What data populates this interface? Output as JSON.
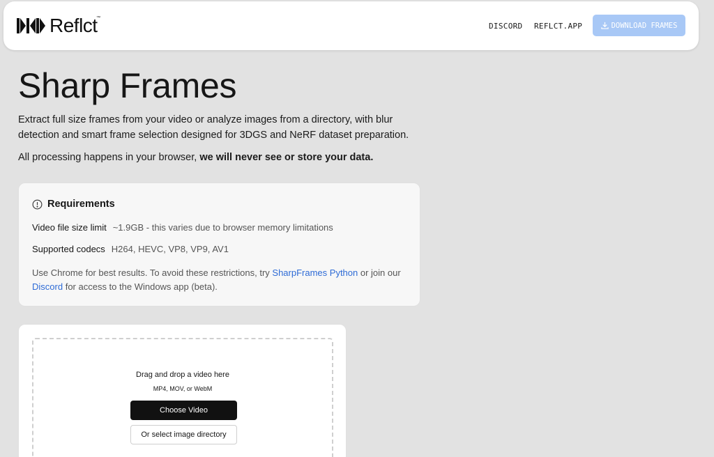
{
  "brand": {
    "name": "Reflct",
    "trademark": "™"
  },
  "nav": {
    "discord": "DISCORD",
    "app": "REFLCT.APP",
    "download": "DOWNLOAD FRAMES",
    "download_icon": "download-icon"
  },
  "hero": {
    "title": "Sharp Frames",
    "description": "Extract full size frames from your video or analyze images from a directory, with blur detection and smart frame selection designed for 3DGS and NeRF dataset preparation.",
    "privacy_prefix": "All processing happens in your browser,",
    "privacy_bold": "we will never see or store your data."
  },
  "requirements": {
    "icon": "alert-circle-icon",
    "title": "Requirements",
    "size_label": "Video file size limit",
    "size_value": "~1.9GB - this varies due to browser memory limitations",
    "codec_label": "Supported codecs",
    "codec_value": "H264, HEVC, VP8, VP9, AV1",
    "note_prefix": "Use Chrome for best results. To avoid these restrictions, try",
    "python_link": "SharpFrames Python",
    "note_mid": "or join our",
    "discord_link": "Discord",
    "note_suffix": "for access to the Windows app (beta)."
  },
  "upload": {
    "drop_title": "Drag and drop a video here",
    "drop_formats": "MP4, MOV, or WebM",
    "choose_button": "Choose Video",
    "directory_button": "Or select image directory"
  },
  "colors": {
    "background": "#e2e2e2",
    "download_button": "#a8c8f6",
    "link": "#2e6bd6",
    "primary_button": "#111111"
  }
}
